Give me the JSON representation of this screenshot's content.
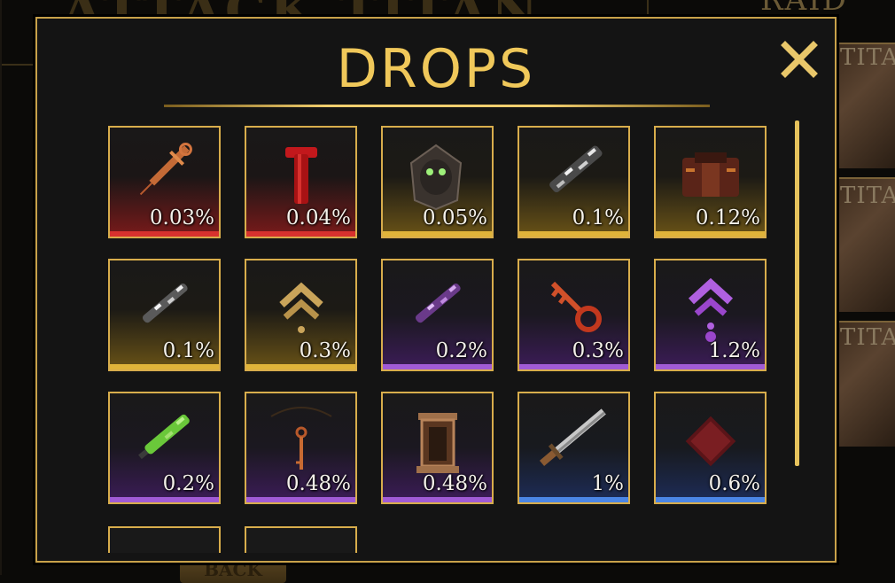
{
  "background": {
    "title_text": "ATTACK TITAN",
    "raid_label": "RAID",
    "card_labels": [
      "TITAN",
      "TITAN",
      "TITAN"
    ],
    "back_label": "BACK"
  },
  "modal": {
    "title": "DROPS",
    "close_icon": "close-x-icon"
  },
  "colors": {
    "accent_gold": "#f0c85a",
    "border_gold": "#d8ad4c",
    "rarity_red": "#d8322e",
    "rarity_gold": "#e0b43a",
    "rarity_purple": "#a15bd6",
    "rarity_blue": "#4b86e6"
  },
  "drops": [
    {
      "rate": "0.03%",
      "rarity": "red",
      "icon": "syringe-icon"
    },
    {
      "rate": "0.04%",
      "rarity": "red",
      "icon": "red-scroll-icon"
    },
    {
      "rate": "0.05%",
      "rarity": "gold",
      "icon": "hooded-mask-icon"
    },
    {
      "rate": "0.1%",
      "rarity": "gold",
      "icon": "chain-crystal-icon"
    },
    {
      "rate": "0.12%",
      "rarity": "gold",
      "icon": "armor-vest-icon"
    },
    {
      "rate": "0.1%",
      "rarity": "gold",
      "icon": "crystal-shard-icon"
    },
    {
      "rate": "0.3%",
      "rarity": "gold",
      "icon": "rank-chevron-gold-icon"
    },
    {
      "rate": "0.2%",
      "rarity": "purple",
      "icon": "purple-shard-icon"
    },
    {
      "rate": "0.3%",
      "rarity": "purple",
      "icon": "red-key-icon"
    },
    {
      "rate": "1.2%",
      "rarity": "purple",
      "icon": "rank-chevron-purple-icon"
    },
    {
      "rate": "0.2%",
      "rarity": "purple",
      "icon": "green-shard-icon"
    },
    {
      "rate": "0.48%",
      "rarity": "purple",
      "icon": "pendant-key-icon"
    },
    {
      "rate": "0.48%",
      "rarity": "purple",
      "icon": "lantern-icon"
    },
    {
      "rate": "1%",
      "rarity": "blue",
      "icon": "blade-icon"
    },
    {
      "rate": "0.6%",
      "rarity": "blue",
      "icon": "red-cube-icon"
    }
  ]
}
